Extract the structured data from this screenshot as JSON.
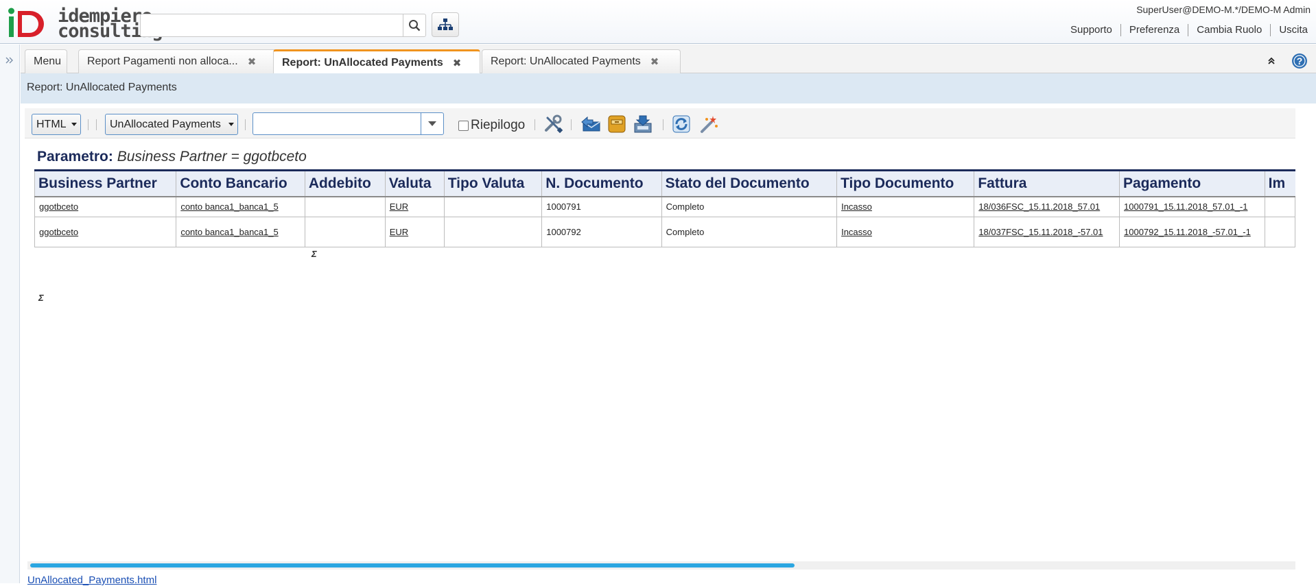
{
  "header": {
    "logo_line1": "idempiere",
    "logo_line2": "consulting",
    "search_placeholder": "",
    "user": "SuperUser@DEMO-M.*/DEMO-M Admin",
    "links": [
      "Supporto",
      "Preferenza",
      "Cambia Ruolo",
      "Uscita"
    ]
  },
  "tabs": [
    {
      "label": "Menu",
      "closable": false,
      "active": false
    },
    {
      "label": "Report Pagamenti non alloca...",
      "closable": true,
      "active": false
    },
    {
      "label": "Report: UnAllocated Payments",
      "closable": true,
      "active": true
    },
    {
      "label": "Report: UnAllocated Payments",
      "closable": true,
      "active": false
    }
  ],
  "title": "Report: UnAllocated Payments",
  "toolbar": {
    "format": "HTML",
    "print_format": "UnAllocated Payments",
    "combo_value": "",
    "summary_label": "Riepilogo",
    "summary_checked": false
  },
  "report": {
    "param_label": "Parametro:",
    "param_value": "Business Partner = ggotbceto",
    "columns": [
      "Business Partner",
      "Conto Bancario",
      "Addebito",
      "Valuta",
      "Tipo Valuta",
      "N. Documento",
      "Stato del Documento",
      "Tipo Documento",
      "Fattura",
      "Pagamento",
      "Im"
    ],
    "rows": [
      [
        "ggotbceto",
        "conto banca1_banca1_5",
        "",
        "EUR",
        "",
        "1000791",
        "Completo",
        "Incasso",
        "18/036FSC_15.11.2018_57.01",
        "1000791_15.11.2018_57.01_-1",
        ""
      ],
      [
        "ggotbceto",
        "conto banca1_banca1_5",
        "",
        "EUR",
        "",
        "1000792",
        "Completo",
        "Incasso",
        "18/037FSC_15.11.2018_-57.01",
        "1000792_15.11.2018_-57.01_-1",
        ""
      ]
    ],
    "sum_symbol": "Σ",
    "footer_link": "UnAllocated_Payments.html"
  },
  "colors": {
    "accent_tab": "#f0931e",
    "header_navy": "#1b2a5a",
    "title_bar": "#dce8f3",
    "scroll_thumb": "#2ba6e1"
  }
}
